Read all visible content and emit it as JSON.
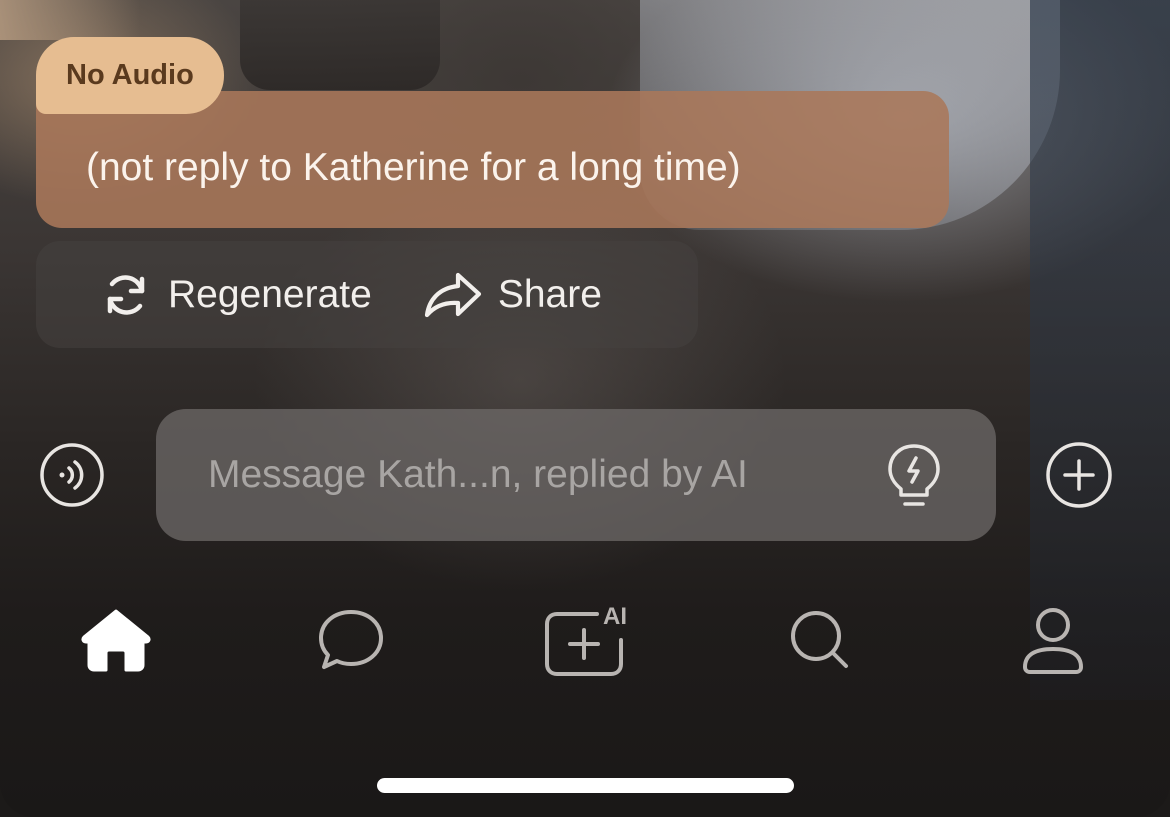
{
  "message": {
    "badge_label": "No Audio",
    "text": "(not reply to Katherine for a long time)"
  },
  "actions": {
    "regenerate_label": "Regenerate",
    "share_label": "Share"
  },
  "composer": {
    "placeholder": "Message Kath...n, replied by AI",
    "voice_icon": "voice-wave-icon",
    "hint_icon": "lightbulb-icon",
    "plus_icon": "plus-circle-icon"
  },
  "tabbar": {
    "items": [
      {
        "icon": "home-icon",
        "active": true
      },
      {
        "icon": "chat-bubble-icon",
        "active": false
      },
      {
        "icon": "ai-create-icon",
        "badge": "AI",
        "active": false
      },
      {
        "icon": "search-icon",
        "active": false
      },
      {
        "icon": "profile-icon",
        "active": false
      }
    ]
  },
  "colors": {
    "badge_bg": "#e6bd91",
    "badge_text": "#5a3a1e",
    "bubble_bg": "#aa785a"
  }
}
